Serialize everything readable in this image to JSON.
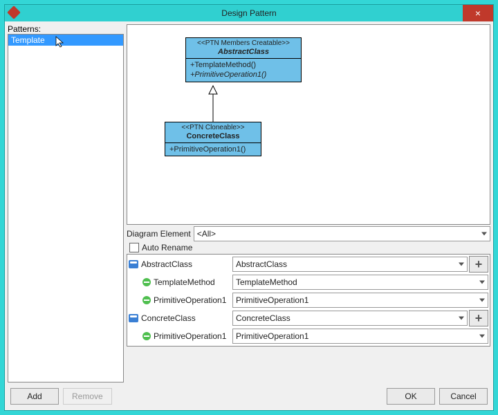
{
  "window": {
    "title": "Design Pattern",
    "close_symbol": "×"
  },
  "sidebar": {
    "label": "Patterns:",
    "items": [
      "Template"
    ]
  },
  "diagram": {
    "nodes": [
      {
        "stereotype": "<<PTN Members Creatable>>",
        "name": "AbstractClass",
        "ops": [
          "+TemplateMethod()",
          "+PrimitiveOperation1()"
        ],
        "abstract_ops_idx": [
          1
        ]
      },
      {
        "stereotype": "<<PTN Cloneable>>",
        "name": "ConcreteClass",
        "ops": [
          "+PrimitiveOperation1()"
        ]
      }
    ]
  },
  "diagram_element": {
    "label": "Diagram Element",
    "value": "<All>"
  },
  "auto_rename": {
    "label": "Auto Rename",
    "checked": false
  },
  "grid": {
    "rows": [
      {
        "kind": "class",
        "name": "AbstractClass",
        "value": "AbstractClass",
        "add": true
      },
      {
        "kind": "op",
        "name": "TemplateMethod",
        "value": "TemplateMethod",
        "indent": true
      },
      {
        "kind": "op",
        "name": "PrimitiveOperation1",
        "value": "PrimitiveOperation1",
        "indent": true
      },
      {
        "kind": "class",
        "name": "ConcreteClass",
        "value": "ConcreteClass",
        "add": true
      },
      {
        "kind": "op",
        "name": "PrimitiveOperation1",
        "value": "PrimitiveOperation1",
        "indent": true
      }
    ]
  },
  "footer": {
    "add": "Add",
    "remove": "Remove",
    "ok": "OK",
    "cancel": "Cancel"
  }
}
